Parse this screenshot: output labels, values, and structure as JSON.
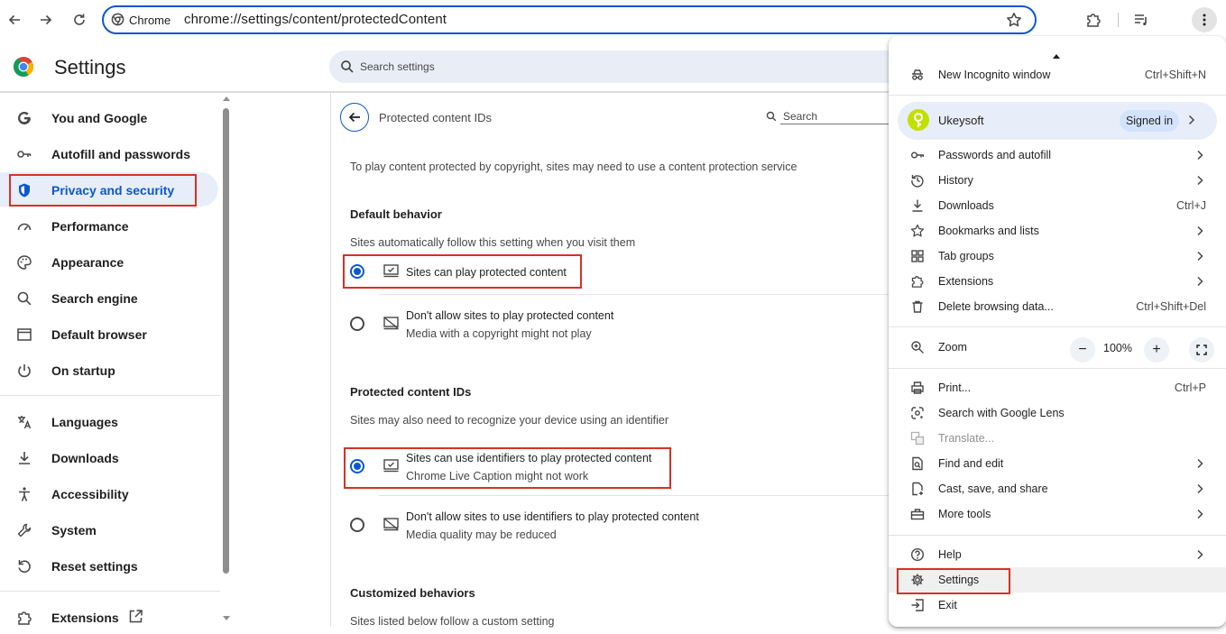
{
  "toolbar": {
    "chip_label": "Chrome",
    "url": "chrome://settings/content/protectedContent"
  },
  "header": {
    "title": "Settings",
    "search_placeholder": "Search settings"
  },
  "sidebar": {
    "items": [
      {
        "label": "You and Google",
        "icon": "google-g-icon"
      },
      {
        "label": "Autofill and passwords",
        "icon": "key-icon"
      },
      {
        "label": "Privacy and security",
        "icon": "shield-icon",
        "active": true
      },
      {
        "label": "Performance",
        "icon": "speedometer-icon"
      },
      {
        "label": "Appearance",
        "icon": "palette-icon"
      },
      {
        "label": "Search engine",
        "icon": "search-icon"
      },
      {
        "label": "Default browser",
        "icon": "browser-window-icon"
      },
      {
        "label": "On startup",
        "icon": "power-icon"
      },
      {
        "label": "Languages",
        "icon": "translate-icon"
      },
      {
        "label": "Downloads",
        "icon": "download-icon"
      },
      {
        "label": "Accessibility",
        "icon": "accessibility-icon"
      },
      {
        "label": "System",
        "icon": "wrench-icon"
      },
      {
        "label": "Reset settings",
        "icon": "reset-icon"
      },
      {
        "label": "Extensions",
        "icon": "puzzle-icon"
      }
    ]
  },
  "panel": {
    "title": "Protected content IDs",
    "search_label": "Search",
    "intro": "To play content protected by copyright, sites may need to use a content protection service",
    "default_heading": "Default behavior",
    "default_desc": "Sites automatically follow this setting when you visit them",
    "option_allow": "Sites can play protected content",
    "option_block": "Don't allow sites to play protected content",
    "option_block_sub": "Media with a copyright might not play",
    "ids_heading": "Protected content IDs",
    "ids_desc": "Sites may also need to recognize your device using an identifier",
    "ids_allow": "Sites can use identifiers to play protected content",
    "ids_allow_sub": "Chrome Live Caption might not work",
    "ids_block": "Don't allow sites to use identifiers to play protected content",
    "ids_block_sub": "Media quality may be reduced",
    "custom_heading": "Customized behaviors",
    "custom_desc": "Sites listed below follow a custom setting"
  },
  "menu": {
    "incognito": {
      "label": "New Incognito window",
      "shortcut": "Ctrl+Shift+N"
    },
    "profile": {
      "name": "Ukeysoft",
      "status": "Signed in"
    },
    "passwords": "Passwords and autofill",
    "history": "History",
    "downloads": {
      "label": "Downloads",
      "shortcut": "Ctrl+J"
    },
    "bookmarks": "Bookmarks and lists",
    "tab_groups": "Tab groups",
    "extensions": "Extensions",
    "delete_data": {
      "label": "Delete browsing data...",
      "shortcut": "Ctrl+Shift+Del"
    },
    "zoom": {
      "label": "Zoom",
      "minus": "−",
      "value": "100%",
      "plus": "+"
    },
    "print": {
      "label": "Print...",
      "shortcut": "Ctrl+P"
    },
    "lens": "Search with Google Lens",
    "translate": "Translate...",
    "find_edit": "Find and edit",
    "cast": "Cast, save, and share",
    "more_tools": "More tools",
    "help": "Help",
    "settings": "Settings",
    "exit": "Exit"
  },
  "colors": {
    "accent": "#0b57d0",
    "highlight_box": "#d93025",
    "active_nav_bg": "#e8eef9"
  }
}
